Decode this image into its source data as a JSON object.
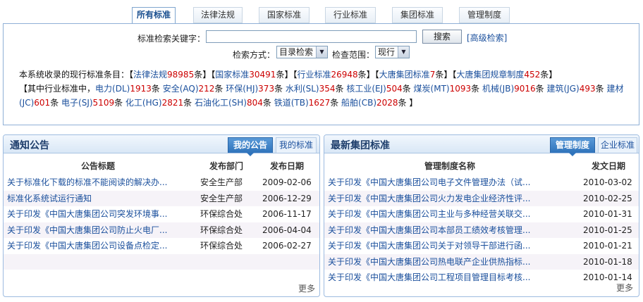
{
  "tabs": [
    {
      "label": "所有标准",
      "active": true
    },
    {
      "label": "法律法规",
      "active": false
    },
    {
      "label": "国家标准",
      "active": false
    },
    {
      "label": "行业标准",
      "active": false
    },
    {
      "label": "集团标准",
      "active": false
    },
    {
      "label": "管理制度",
      "active": false
    }
  ],
  "search": {
    "keyword_label": "标准检索关键字：",
    "keyword_value": "",
    "button_label": "搜索",
    "advanced_label": "[高级检索]",
    "mode_label": "检索方式：",
    "mode_value": "目录检索",
    "scope_label": "检查范围：",
    "scope_value": "现行"
  },
  "stats": {
    "intro": "本系统收录的现行标准条目：【",
    "categories": [
      {
        "name": "法律法规",
        "count": "98985",
        "unit": "条】【"
      },
      {
        "name": "国家标准",
        "count": "30491",
        "unit": "条】【"
      },
      {
        "name": "行业标准",
        "count": "26948",
        "unit": "条】【"
      },
      {
        "name": "大唐集团标准",
        "count": "7",
        "unit": "条】【"
      },
      {
        "name": "大唐集团规章制度",
        "count": "452",
        "unit": "条】"
      }
    ],
    "industry_intro": "【其中行业标准中，",
    "industry": [
      {
        "name": "电力(DL)",
        "count": "1913",
        "unit": "条 "
      },
      {
        "name": "安全(AQ)",
        "count": "212",
        "unit": "条 "
      },
      {
        "name": "环保(HJ)",
        "count": "373",
        "unit": "条 "
      },
      {
        "name": "水利(SL)",
        "count": "354",
        "unit": "条 "
      },
      {
        "name": "核工业(EJ)",
        "count": "504",
        "unit": "条 "
      },
      {
        "name": "煤炭(MT)",
        "count": "1093",
        "unit": "条 "
      },
      {
        "name": "机械(JB)",
        "count": "9016",
        "unit": "条 "
      },
      {
        "name": "建筑(JG)",
        "count": "493",
        "unit": "条 "
      },
      {
        "name": "建材(JC)",
        "count": "601",
        "unit": "条 "
      },
      {
        "name": "电子(SJ)",
        "count": "5109",
        "unit": "条 "
      },
      {
        "name": "化工(HG)",
        "count": "2821",
        "unit": "条 "
      },
      {
        "name": "石油化工(SH)",
        "count": "804",
        "unit": "条 "
      },
      {
        "name": "铁道(TB)",
        "count": "1627",
        "unit": "条 "
      },
      {
        "name": "船舶(CB)",
        "count": "2028",
        "unit": "条 "
      }
    ],
    "industry_end": "】"
  },
  "notice_panel": {
    "title": "通知公告",
    "tab_on": "我的公告",
    "tab_off": "我的标准",
    "col1": "公告标题",
    "col2": "发布部门",
    "col3": "发布日期",
    "rows": [
      {
        "title": "关于标准化下载的标准不能阅读的解决办...",
        "dept": "安全生产部",
        "date": "2009-02-06"
      },
      {
        "title": "标准化系统试运行通知",
        "dept": "安全生产部",
        "date": "2006-12-29"
      },
      {
        "title": "关于印发《中国大唐集团公司突发环境事...",
        "dept": "环保综合处",
        "date": "2006-11-17"
      },
      {
        "title": "关于印发《中国大唐集团公司防止火电厂...",
        "dept": "环保综合处",
        "date": "2006-04-04"
      },
      {
        "title": "关于印发《中国大唐集团公司设备点检定...",
        "dept": "环保综合处",
        "date": "2006-02-27"
      }
    ],
    "more": "更多"
  },
  "group_panel": {
    "title": "最新集团标准",
    "tab_on": "管理制度",
    "tab_off": "企业标准",
    "col1": "管理制度名称",
    "col2": "发文日期",
    "rows": [
      {
        "title": "关于印发《中国大唐集团公司电子文件管理办法（试...",
        "date": "2010-03-02"
      },
      {
        "title": "关于印发《中国大唐集团公司火力发电企业经济性评...",
        "date": "2010-02-25"
      },
      {
        "title": "关于印发《中国大唐集团公司主业与多种经营关联交...",
        "date": "2010-01-31"
      },
      {
        "title": "关于印发《中国大唐集团公司本部员工绩效考核管理...",
        "date": "2010-01-25"
      },
      {
        "title": "关于印发《中国大唐集团公司关于对领导干部进行函...",
        "date": "2010-01-21"
      },
      {
        "title": "关于印发《中国大唐集团公司热电联产企业供热指标...",
        "date": "2010-01-18"
      },
      {
        "title": "关于印发《中国大唐集团公司工程项目管理目标考核...",
        "date": "2010-01-14"
      }
    ],
    "more": "更多"
  }
}
